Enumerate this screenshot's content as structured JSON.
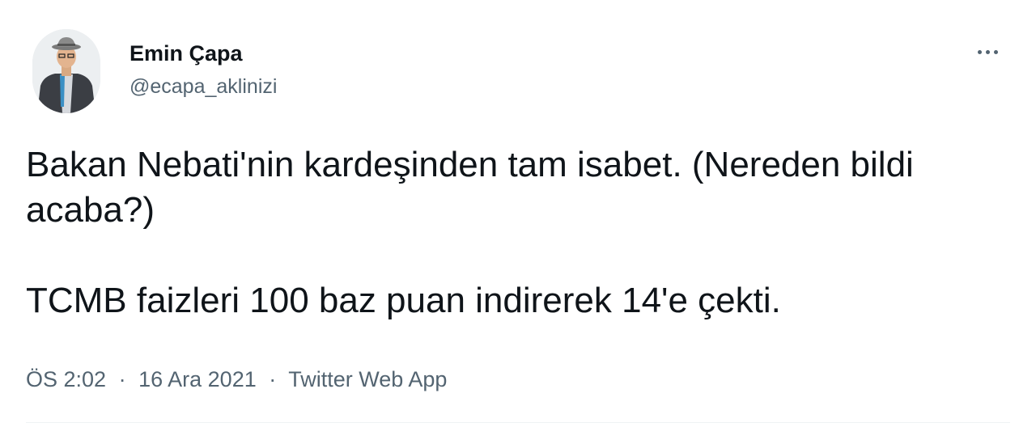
{
  "author": {
    "display_name": "Emin Çapa",
    "handle": "@ecapa_aklinizi",
    "avatar": "profile-photo"
  },
  "tweet": {
    "paragraphs": [
      "Bakan Nebati'nin kardeşinden tam isabet. (Nereden bildi acaba?)",
      "TCMB faizleri 100 baz puan indirerek 14'e çekti."
    ],
    "time": "ÖS 2:02",
    "date": "16 Ara 2021",
    "source": "Twitter Web App",
    "separator": "·"
  },
  "icons": {
    "more": "more-horizontal-icon"
  },
  "colors": {
    "text_primary": "#0f1419",
    "text_secondary": "#536471",
    "divider": "#eff3f4"
  }
}
